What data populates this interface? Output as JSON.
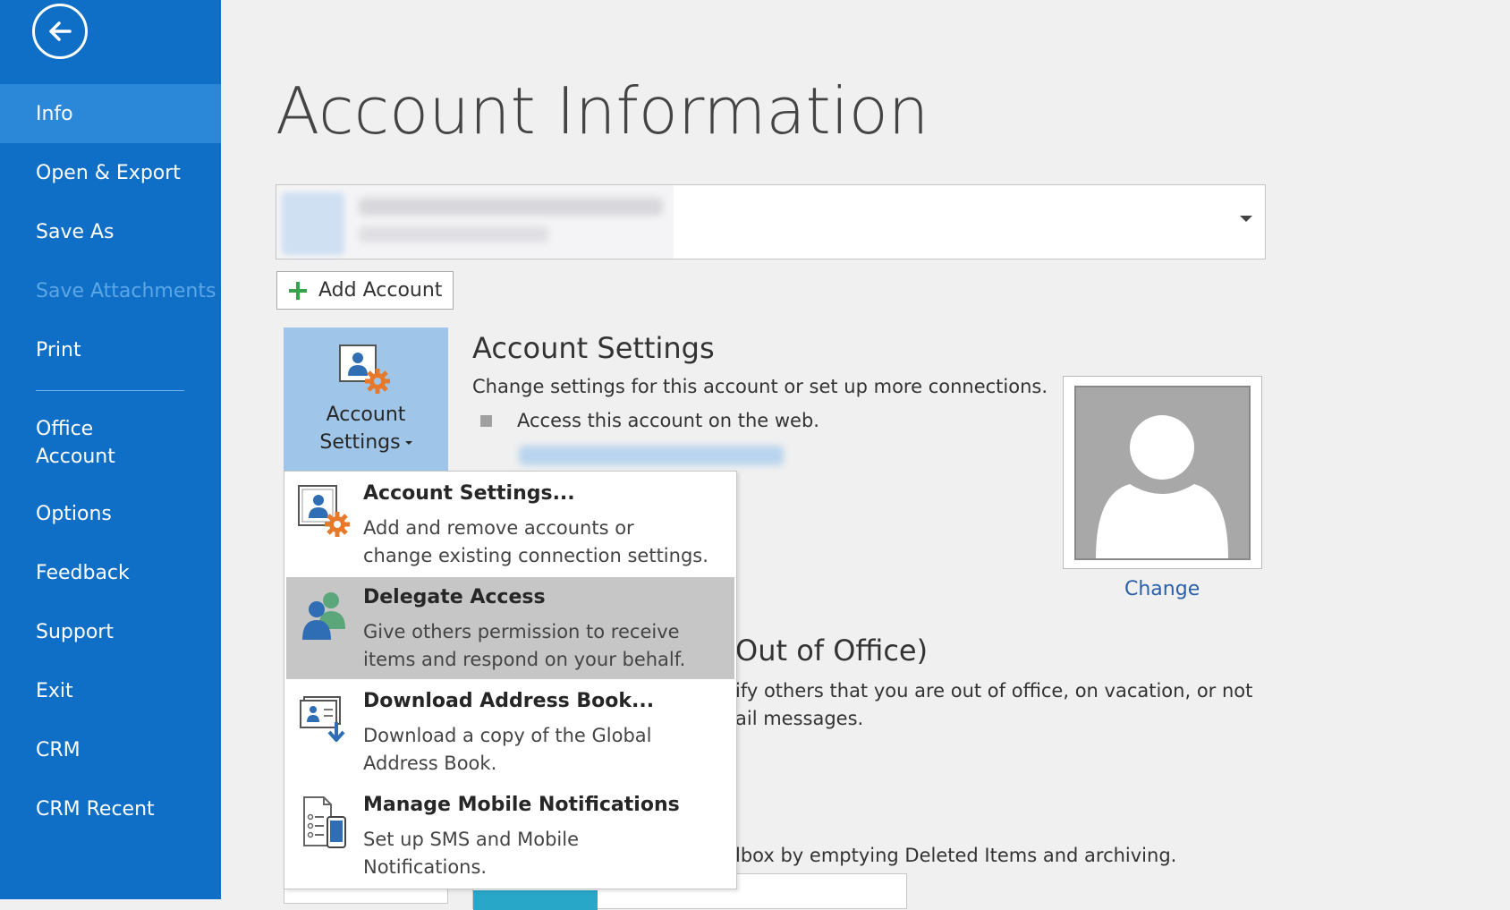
{
  "sidebar": {
    "back_label": "Back",
    "items": [
      {
        "label": "Info",
        "active": true
      },
      {
        "label": "Open & Export"
      },
      {
        "label": "Save As"
      },
      {
        "label": "Save Attachments",
        "disabled": true
      },
      {
        "label": "Print"
      },
      {
        "label": "Office Account"
      },
      {
        "label": "Options"
      },
      {
        "label": "Feedback"
      },
      {
        "label": "Support"
      },
      {
        "label": "Exit"
      },
      {
        "label": "CRM"
      },
      {
        "label": "CRM Recent"
      }
    ],
    "office_account_lines": [
      "Office",
      "Account"
    ]
  },
  "main": {
    "title": "Account Information",
    "add_account_label": "Add Account",
    "account_settings_section": {
      "button_line1": "Account",
      "button_line2": "Settings",
      "title": "Account Settings",
      "description": "Change settings for this account or set up more connections.",
      "bullet": "Access this account on the web."
    },
    "change_label": "Change",
    "ooo_title_partial": "Out of Office)",
    "ooo_desc_line1_partial": "ify others that you are out of office, on vacation, or not",
    "ooo_desc_line2_partial": "ail messages.",
    "mailbox_desc_partial": "lbox by emptying Deleted Items and archiving."
  },
  "menu": {
    "items": [
      {
        "title": "Account Settings...",
        "desc_lines": [
          "Add and remove accounts or",
          "change existing connection settings."
        ],
        "icon": "account-settings-icon"
      },
      {
        "title": "Delegate Access",
        "desc_lines": [
          "Give others permission to receive",
          "items and respond on your behalf."
        ],
        "icon": "delegate-icon",
        "hover": true
      },
      {
        "title": "Download Address Book...",
        "desc_lines": [
          "Download a copy of the Global",
          "Address Book."
        ],
        "icon": "address-book-download-icon"
      },
      {
        "title": "Manage Mobile Notifications",
        "desc_lines": [
          "Set up SMS and Mobile",
          "Notifications."
        ],
        "icon": "mobile-notifications-icon"
      }
    ]
  },
  "colors": {
    "sidebar_bg": "#0f6fc6",
    "sidebar_active": "#2b88d8",
    "button_selected": "#9fc6e8",
    "menu_hover": "#c6c6c6",
    "link": "#2b5fa7",
    "accent_orange": "#e8792b"
  }
}
